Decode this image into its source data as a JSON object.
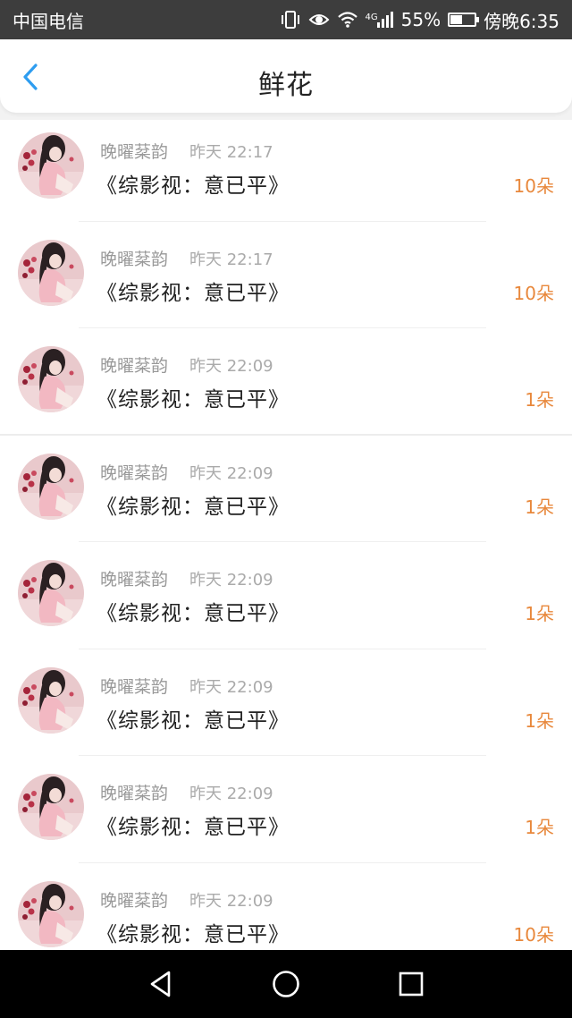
{
  "status_bar": {
    "carrier": "中国电信",
    "network_tag": "4G",
    "battery_percent": "55%",
    "battery_level": 0.55,
    "time": "傍晚6:35",
    "icons": [
      "vibrate-icon",
      "eye-icon",
      "wifi-icon",
      "signal-icon",
      "battery-icon"
    ]
  },
  "header": {
    "title": "鲜花",
    "back_icon": "chevron-left-icon",
    "accent_color": "#2e9df0"
  },
  "colors": {
    "flower_count": "#e8883c",
    "username": "#999999",
    "title_text": "#222222"
  },
  "list": {
    "items": [
      {
        "username": "晚曜棻韵",
        "time": "昨天 22:17",
        "book": "《综影视：意已平》",
        "count": "10朵"
      },
      {
        "username": "晚曜棻韵",
        "time": "昨天 22:17",
        "book": "《综影视：意已平》",
        "count": "10朵"
      },
      {
        "username": "晚曜棻韵",
        "time": "昨天 22:09",
        "book": "《综影视：意已平》",
        "count": "1朵"
      },
      {
        "username": "晚曜棻韵",
        "time": "昨天 22:09",
        "book": "《综影视：意已平》",
        "count": "1朵"
      },
      {
        "username": "晚曜棻韵",
        "time": "昨天 22:09",
        "book": "《综影视：意已平》",
        "count": "1朵"
      },
      {
        "username": "晚曜棻韵",
        "time": "昨天 22:09",
        "book": "《综影视：意已平》",
        "count": "1朵"
      },
      {
        "username": "晚曜棻韵",
        "time": "昨天 22:09",
        "book": "《综影视：意已平》",
        "count": "1朵"
      },
      {
        "username": "晚曜棻韵",
        "time": "昨天 22:09",
        "book": "《综影视：意已平》",
        "count": "10朵"
      }
    ]
  },
  "nav_bar": {
    "icons": [
      "back-triangle-icon",
      "home-circle-icon",
      "recents-square-icon"
    ]
  }
}
